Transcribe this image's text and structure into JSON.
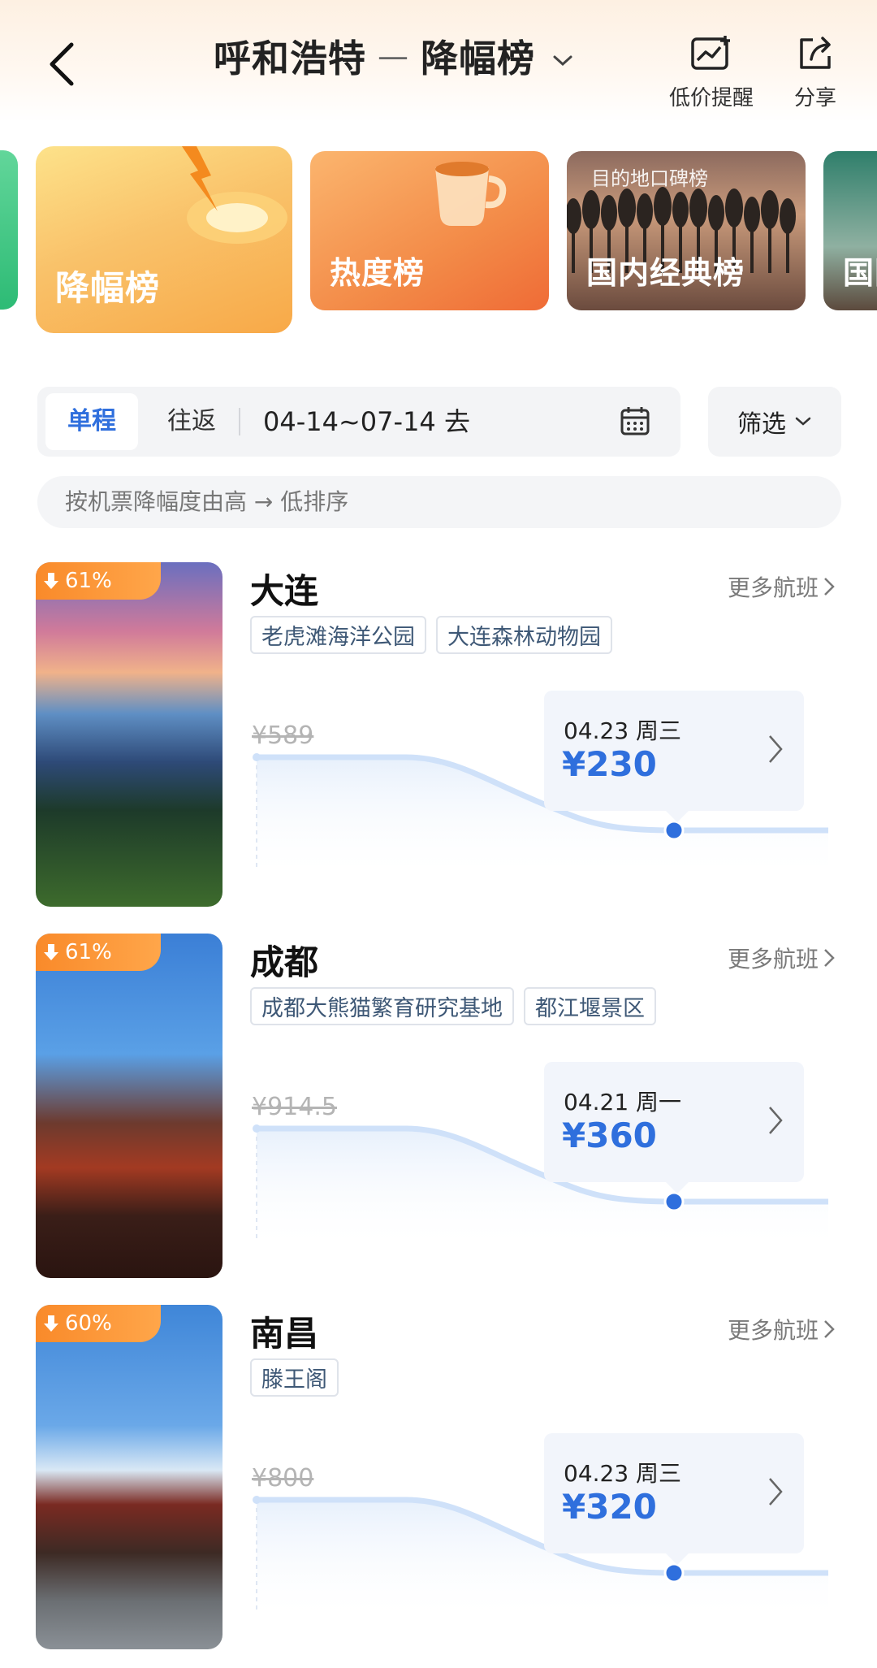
{
  "header": {
    "origin": "呼和浩特",
    "separator": "—",
    "list_name": "降幅榜",
    "price_alert_label": "低价提醒",
    "share_label": "分享"
  },
  "categories": [
    {
      "label": "降幅榜",
      "active": true
    },
    {
      "label": "热度榜"
    },
    {
      "label": "国内经典榜",
      "tagline": "目的地口碑榜"
    },
    {
      "label": "国际"
    }
  ],
  "trip": {
    "one_way": "单程",
    "round_trip": "往返",
    "date_range": "04-14~07-14 去",
    "filter_label": "筛选"
  },
  "sort_hint": "按机票降幅度由高 → 低排序",
  "destinations": [
    {
      "discount": "61%",
      "city": "大连",
      "more_label": "更多航班",
      "tags": [
        "老虎滩海洋公园",
        "大连森林动物园"
      ],
      "original_price": "¥589",
      "date": "04.23 周三",
      "price": "¥230"
    },
    {
      "discount": "61%",
      "city": "成都",
      "more_label": "更多航班",
      "tags": [
        "成都大熊猫繁育研究基地",
        "都江堰景区"
      ],
      "original_price": "¥914.5",
      "date": "04.21 周一",
      "price": "¥360"
    },
    {
      "discount": "60%",
      "city": "南昌",
      "more_label": "更多航班",
      "tags": [
        "滕王阁"
      ],
      "original_price": "¥800",
      "date": "04.23 周三",
      "price": "¥320"
    }
  ],
  "colors": {
    "accent_blue": "#2f6fdd",
    "badge_orange": "#f98a2a"
  }
}
